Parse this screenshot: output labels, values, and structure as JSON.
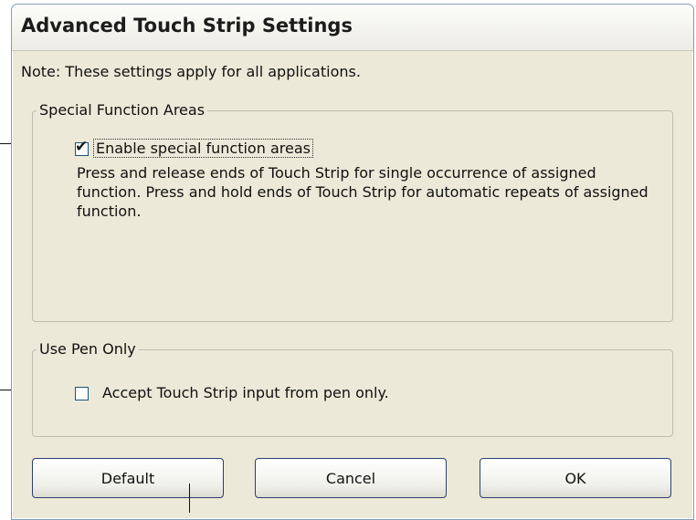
{
  "dialog": {
    "title": "Advanced Touch Strip Settings",
    "note": "Note: These settings apply for all applications."
  },
  "special_function_areas": {
    "legend": "Special Function Areas",
    "checkbox_label": "Enable special function areas",
    "checked": true,
    "description": "Press and release ends of Touch Strip for single occurrence of assigned function. Press and hold ends of Touch Strip for automatic repeats of assigned function."
  },
  "use_pen_only": {
    "legend": "Use Pen Only",
    "checkbox_label": "Accept Touch Strip input from pen only.",
    "checked": false
  },
  "buttons": {
    "default_label": "Default",
    "cancel_label": "Cancel",
    "ok_label": "OK"
  }
}
